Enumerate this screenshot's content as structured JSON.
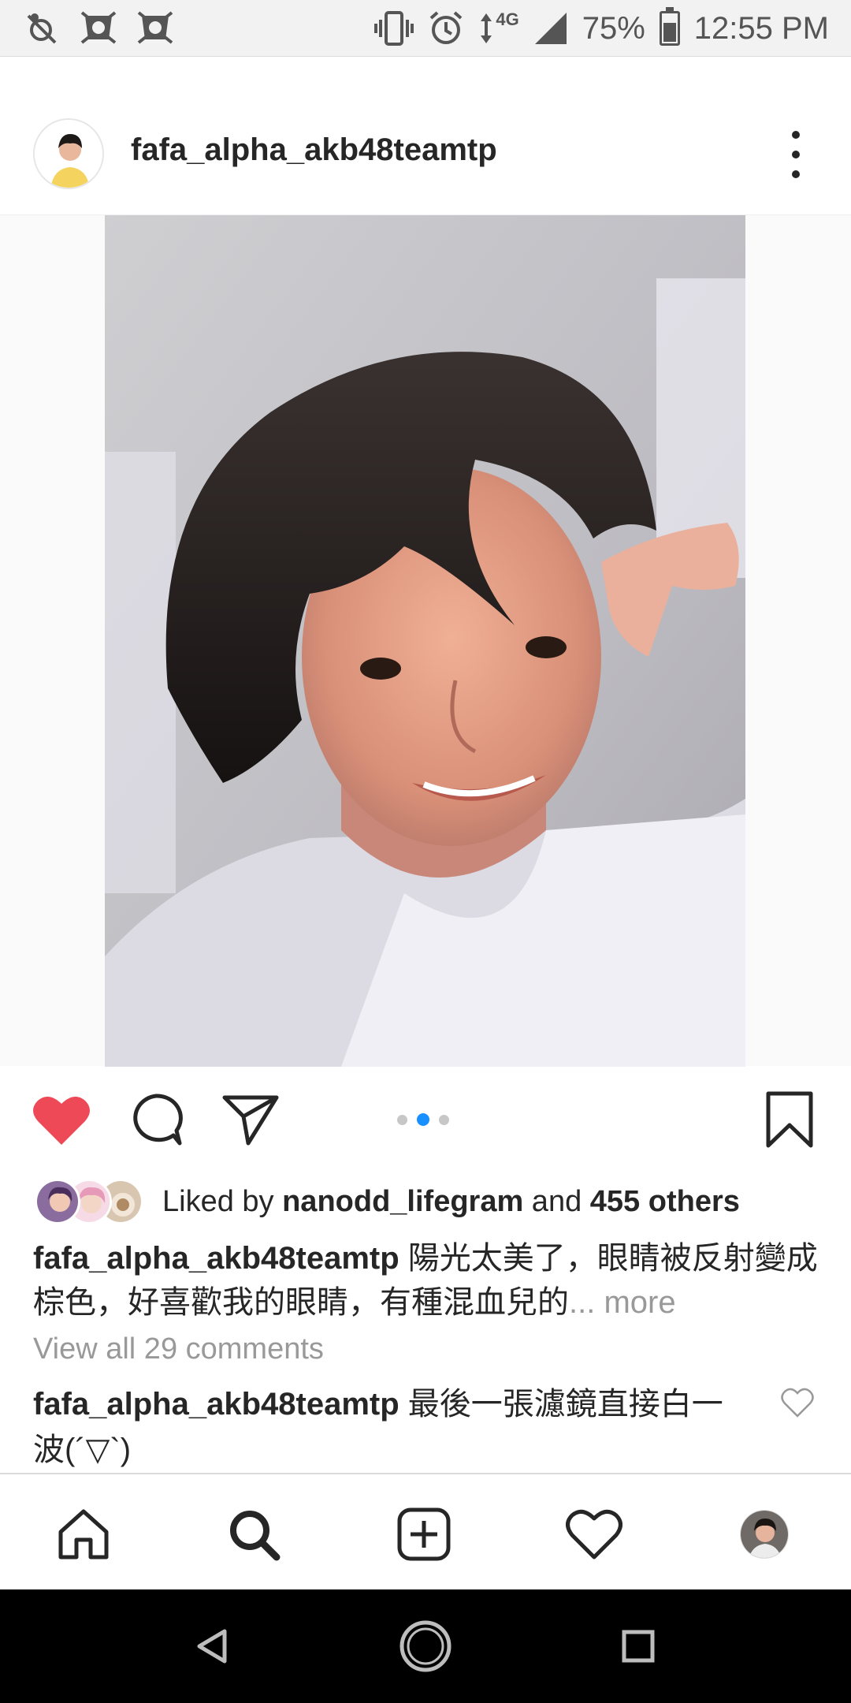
{
  "status_bar": {
    "network": "4G",
    "battery_percent": "75%",
    "battery_level": 0.75,
    "time": "12:55 PM",
    "icons": [
      "signal-off-icon",
      "app-notification-icon",
      "app-notification-icon",
      "vibrate-icon",
      "alarm-icon",
      "data-arrows-icon",
      "cell-signal-icon",
      "battery-icon"
    ]
  },
  "post": {
    "username": "fafa_alpha_akb48teamtp",
    "more_icon": "more-options-icon",
    "carousel": {
      "count": 3,
      "active_index": 1
    },
    "actions": {
      "like_icon": "heart-filled-icon",
      "comment_icon": "comment-icon",
      "share_icon": "send-icon",
      "save_icon": "bookmark-icon"
    },
    "likes": {
      "prefix": "Liked by ",
      "first_liker": "nanodd_lifegram",
      "connector": " and ",
      "others": "455 others"
    },
    "caption": {
      "username": "fafa_alpha_akb48teamtp",
      "text": " 陽光太美了，眼睛被反射變成棕色，好喜歡我的眼睛，有種混血兒的",
      "more": "... more"
    },
    "view_all_comments": "View all 29 comments",
    "top_comment": {
      "username": "fafa_alpha_akb48teamtp",
      "text": " 最後一張濾鏡直接白一波(´▽`)"
    }
  },
  "bottom_nav": {
    "items": [
      "home-icon",
      "search-icon",
      "new-post-icon",
      "activity-heart-icon",
      "profile-avatar"
    ]
  },
  "system_nav": {
    "items": [
      "back-icon",
      "home-circle-icon",
      "recents-icon"
    ]
  },
  "colors": {
    "like_red": "#ed4956",
    "carousel_active": "#1890ff",
    "text": "#262626",
    "muted": "#999999"
  }
}
